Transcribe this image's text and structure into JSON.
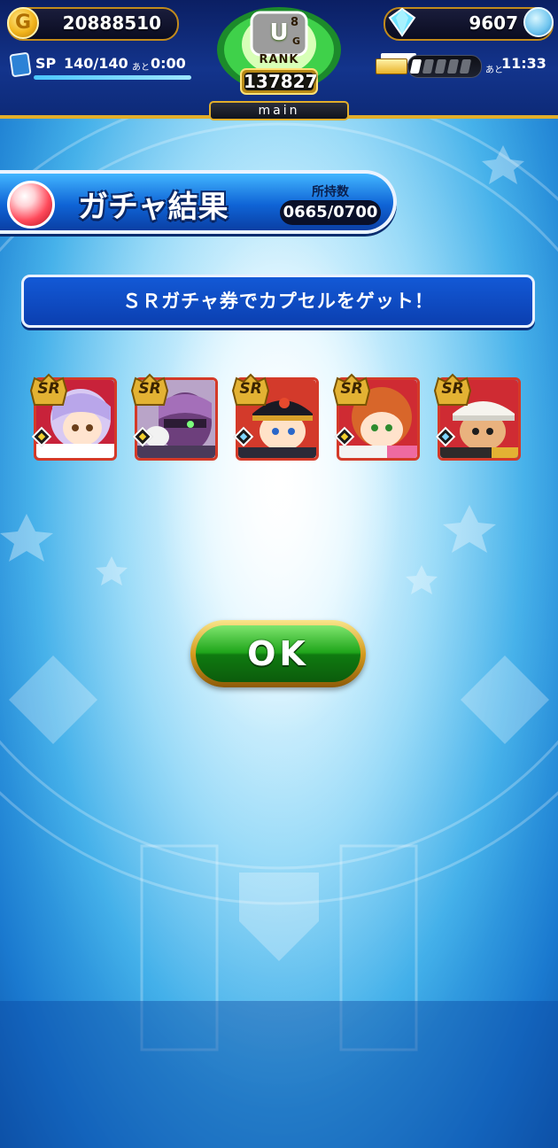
{
  "header": {
    "coins": "20888510",
    "gems": "9607",
    "sp_label": "SP",
    "sp_value": "140/140",
    "sp_ato": "あと",
    "sp_time": "0:00",
    "rank_grade": "U",
    "rank_grade_sup": "8",
    "rank_grade_sub": "G",
    "rank_title": "RANK",
    "rank_value": "137827",
    "mode_tag": "main",
    "pack_ato": "あと",
    "pack_time": "11:33"
  },
  "title_banner": {
    "title": "ガチャ結果",
    "holdings_label": "所持数",
    "holdings_value": "0665/0700"
  },
  "message": "ＳＲガチャ券でカプセルをゲット！",
  "cards": [
    {
      "rarity": "SR",
      "palette": "lavender-hair"
    },
    {
      "rarity": "SR",
      "palette": "purple-masked"
    },
    {
      "rarity": "SR",
      "palette": "black-cap"
    },
    {
      "rarity": "SR",
      "palette": "orange-hair"
    },
    {
      "rarity": "SR",
      "palette": "white-cap"
    }
  ],
  "ok_button": "OK",
  "colors": {
    "accent_gold": "#e2ae2a",
    "banner_blue": "#0f64d6",
    "ok_green": "#1fa51a",
    "card_red": "#d43a28"
  }
}
